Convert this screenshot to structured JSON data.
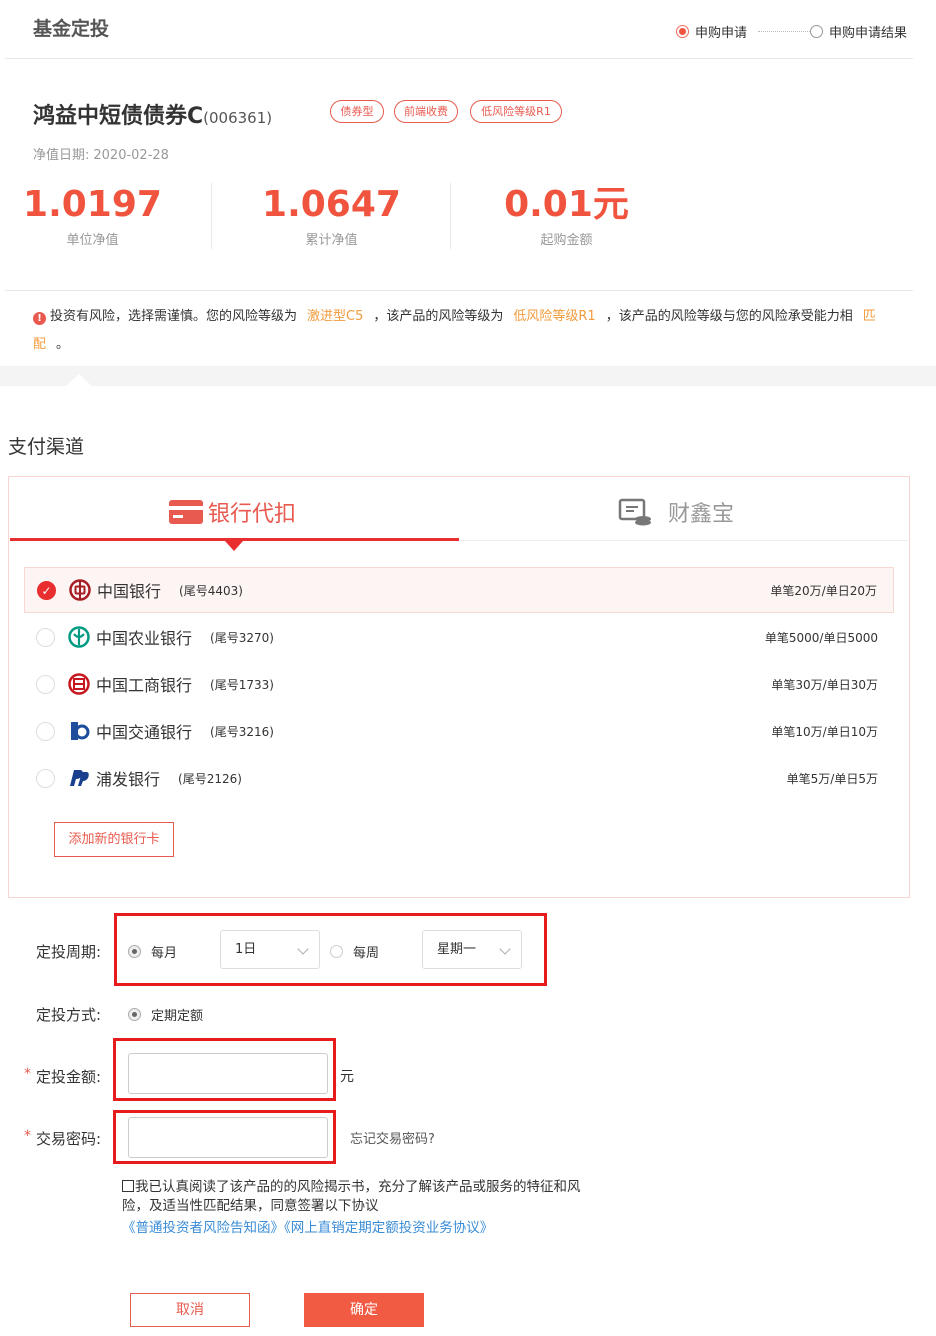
{
  "header": {
    "title": "基金定投",
    "steps": [
      "申购申请",
      "申购申请结果"
    ]
  },
  "fund": {
    "name": "鸿益中短债债券C",
    "code": "(006361)",
    "tags": [
      "债券型",
      "前端收费",
      "低风险等级R1"
    ],
    "nav_date_label": "净值日期:",
    "nav_date": "2020-02-28",
    "stats": [
      {
        "value": "1.0197",
        "label": "单位净值"
      },
      {
        "value": "1.0647",
        "label": "累计净值"
      },
      {
        "value": "0.01元",
        "label": "起购金额"
      }
    ]
  },
  "risk": {
    "t1": "投资有风险，选择需谨慎。您的风险等级为",
    "user_level": "激进型C5",
    "t2": "，该产品的风险等级为",
    "product_level": "低风险等级R1",
    "t3": "，该产品的风险等级与您的风险承受能力相",
    "match": "匹配",
    "t4": "。"
  },
  "payment": {
    "section_title": "支付渠道",
    "tabs": [
      "银行代扣",
      "财鑫宝"
    ],
    "banks": [
      {
        "name": "中国银行",
        "tail": "(尾号4403)",
        "limit": "单笔20万/单日20万",
        "selected": true
      },
      {
        "name": "中国农业银行",
        "tail": "(尾号3270)",
        "limit": "单笔5000/单日5000",
        "selected": false
      },
      {
        "name": "中国工商银行",
        "tail": "(尾号1733)",
        "limit": "单笔30万/单日30万",
        "selected": false
      },
      {
        "name": "中国交通银行",
        "tail": "(尾号3216)",
        "limit": "单笔10万/单日10万",
        "selected": false
      },
      {
        "name": "浦发银行",
        "tail": "(尾号2126)",
        "limit": "单笔5万/单日5万",
        "selected": false
      }
    ],
    "add_card": "添加新的银行卡"
  },
  "form": {
    "cycle_label": "定投周期:",
    "monthly": "每月",
    "month_day": "1日",
    "weekly": "每周",
    "weekday": "星期一",
    "mode_label": "定投方式:",
    "mode_value": "定期定额",
    "amount_label": "定投金额:",
    "amount_unit": "元",
    "amount_value": "",
    "password_label": "交易密码:",
    "password_value": "",
    "forgot": "忘记交易密码?",
    "required_mark": "*"
  },
  "agreement": {
    "text": "我已认真阅读了该产品的的风险揭示书，充分了解该产品或服务的特征和风险，及适当性匹配结果，同意签署以下协议",
    "links": "《普通投资者风险告知函》《网上直销定期定额投资业务协议》"
  },
  "buttons": {
    "cancel": "取消",
    "confirm": "确定"
  },
  "colors": {
    "accent": "#f0543e",
    "highlight": "#f39c3d",
    "link": "#3a8cd6",
    "frame": "#e61c1c"
  }
}
